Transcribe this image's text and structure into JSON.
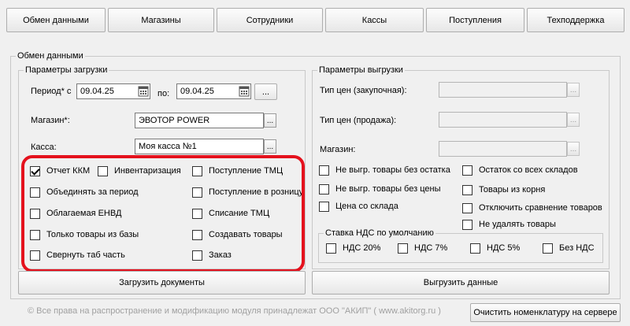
{
  "tabs": [
    "Обмен данными",
    "Магазины",
    "Сотрудники",
    "Кассы",
    "Поступления",
    "Техподдержка"
  ],
  "outer_group_title": "Обмен данными",
  "load": {
    "title": "Параметры загрузки",
    "period_from_label": "Период* с",
    "period_from": "09.04.25",
    "period_to_label": "по:",
    "period_to": "09.04.25",
    "more_label": "...",
    "store_label": "Магазин*:",
    "store_value": "ЭВОТОР POWER",
    "register_label": "Касса:",
    "register_value": "Моя касса №1",
    "pick_label": "...",
    "checkboxes": [
      {
        "label": "Отчет ККМ",
        "checked": true
      },
      {
        "label": "Инвентаризация",
        "checked": false
      },
      {
        "label": "Поступление ТМЦ",
        "checked": false
      },
      {
        "label": "Объединять за период",
        "checked": false
      },
      {
        "label": "Поступление в розницу",
        "checked": false
      },
      {
        "label": "Облагаемая ЕНВД",
        "checked": false
      },
      {
        "label": "Списание ТМЦ",
        "checked": false
      },
      {
        "label": "Только товары из базы",
        "checked": false
      },
      {
        "label": "Создавать товары",
        "checked": false
      },
      {
        "label": "Свернуть таб часть",
        "checked": false
      },
      {
        "label": "Заказ",
        "checked": false
      }
    ],
    "load_button": "Загрузить документы"
  },
  "unload": {
    "title": "Параметры выгрузки",
    "price_purchase_label": "Тип цен (закупочная):",
    "price_sale_label": "Тип цен (продажа):",
    "store_label": "Магазин:",
    "checkboxes": [
      {
        "label": "Не выгр. товары без остатка",
        "checked": false
      },
      {
        "label": "Остаток со всех складов",
        "checked": false
      },
      {
        "label": "Не выгр. товары без цены",
        "checked": false
      },
      {
        "label": "Товары из корня",
        "checked": false
      },
      {
        "label": "Цена со склада",
        "checked": false
      },
      {
        "label": "Отключить сравнение товаров",
        "checked": false
      },
      {
        "label": "Не удалять товары",
        "checked": false
      }
    ],
    "vat_group_title": "Ставка НДС по умолчанию",
    "vat_options": [
      {
        "label": "НДС 20%",
        "checked": false
      },
      {
        "label": "НДС 7%",
        "checked": false
      },
      {
        "label": "НДС 5%",
        "checked": false
      },
      {
        "label": "Без НДС",
        "checked": false
      }
    ],
    "unload_button": "Выгрузить данные"
  },
  "footer": {
    "copyright": "© Все права на распространение и модификацию модуля принадлежат ООО \"АКИП\" ( www.akitorg.ru )",
    "clear_button": "Очистить номенклатуру на сервере"
  },
  "colors": {
    "highlight": "#e4111d",
    "background": "#f0f0f0"
  }
}
